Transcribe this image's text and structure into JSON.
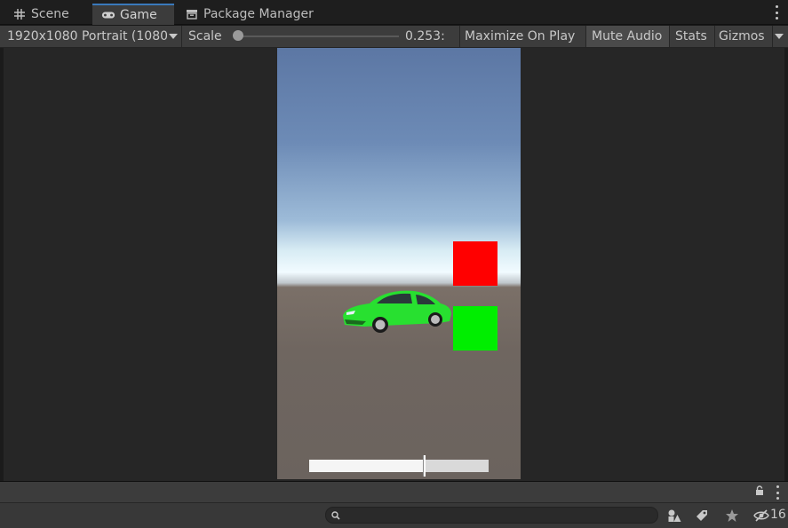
{
  "tabs": [
    {
      "label": "Scene",
      "icon": "grid-icon",
      "active": false
    },
    {
      "label": "Game",
      "icon": "gamepad-icon",
      "active": true
    },
    {
      "label": "Package Manager",
      "icon": "package-icon",
      "active": false
    }
  ],
  "toolbar": {
    "resolution": "1920x1080 Portrait (1080",
    "scale_label": "Scale",
    "scale_value": "0.253:",
    "maximize": "Maximize On Play",
    "mute": "Mute Audio",
    "stats": "Stats",
    "gizmos": "Gizmos"
  },
  "game_view": {
    "ui_slider_value": 0.64,
    "colors": {
      "red_box": "#ff0000",
      "green_box": "#00ee00",
      "car": "#22e02a"
    }
  },
  "console": {
    "hidden_count": "16"
  }
}
